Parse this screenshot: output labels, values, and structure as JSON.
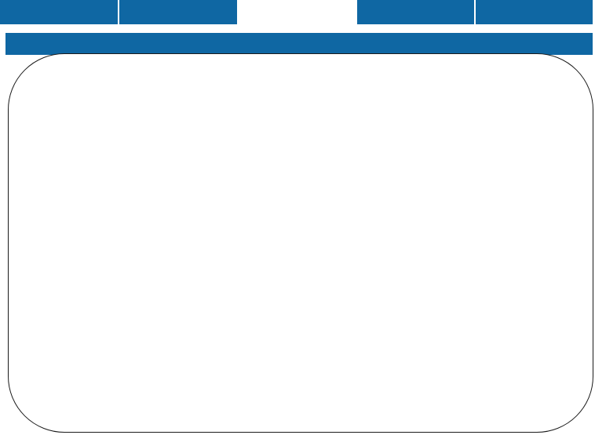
{
  "tabs": [
    {
      "label": "",
      "active": false
    },
    {
      "label": "",
      "active": false
    },
    {
      "label": "",
      "active": true
    },
    {
      "label": "",
      "active": false
    },
    {
      "label": "",
      "active": false
    }
  ],
  "header": {
    "title": ""
  },
  "content": {
    "text": ""
  },
  "colors": {
    "accent": "#0f67a3",
    "background": "#ffffff",
    "frame_border": "#1a1a1a"
  }
}
